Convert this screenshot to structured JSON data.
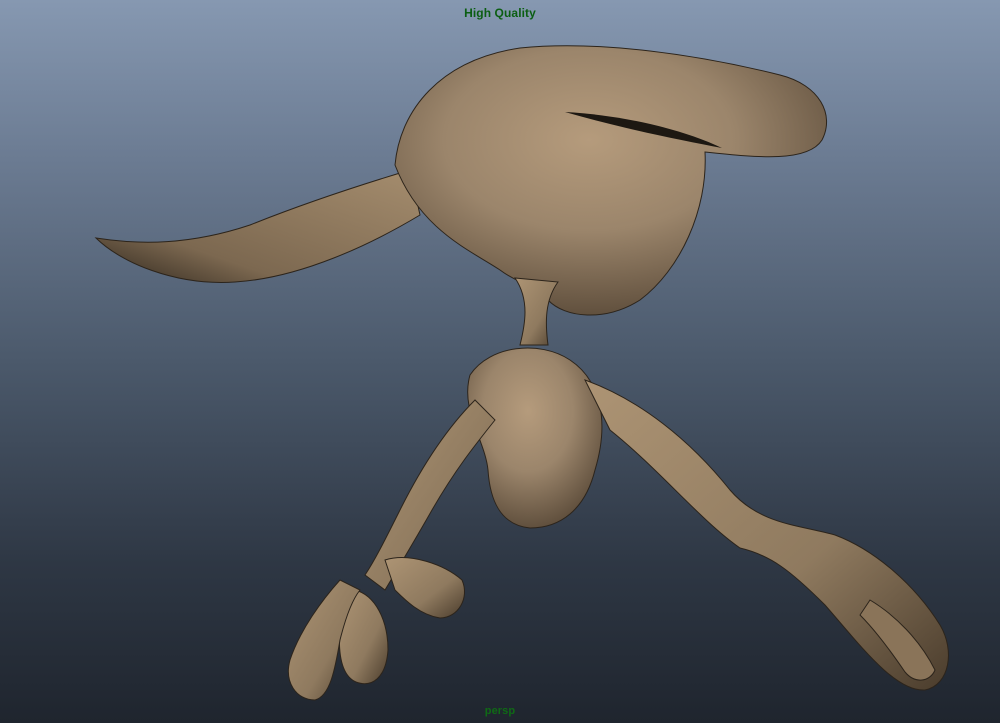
{
  "viewport": {
    "quality_label": "High Quality",
    "camera_label": "persp",
    "hud_color": "#0b5e12",
    "background_top": "#8698b1",
    "background_bottom": "#1f252e"
  },
  "model": {
    "material_color": "#9b856b",
    "shadow_color": "#3f3326"
  }
}
